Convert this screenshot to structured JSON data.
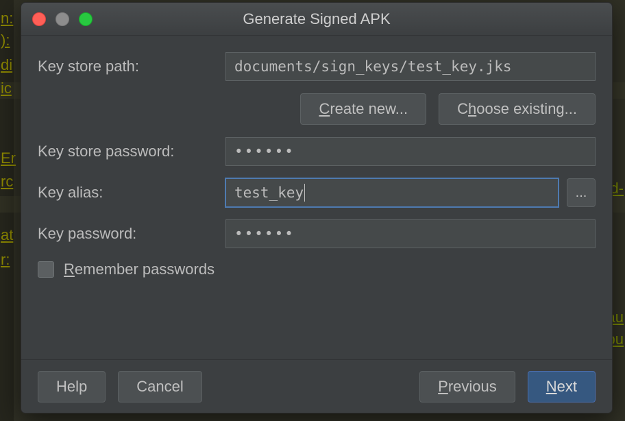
{
  "title": "Generate Signed APK",
  "form": {
    "keystore_path_label": "Key store path:",
    "keystore_path_value": "documents/sign_keys/test_key.jks",
    "create_new_label": "Create new...",
    "choose_existing_label": "Choose existing...",
    "keystore_password_label": "Key store password:",
    "keystore_password_value": "••••••",
    "key_alias_label": "Key alias:",
    "key_alias_value": "test_key",
    "key_alias_browse_label": "...",
    "key_password_label": "Key password:",
    "key_password_value": "••••••",
    "remember_label_pre": "R",
    "remember_label_rest": "emember passwords",
    "remember_checked": false
  },
  "footer": {
    "help_label": "Help",
    "cancel_label": "Cancel",
    "previous_label": "Previous",
    "next_label": "Next"
  },
  "colors": {
    "dialog_bg": "#3c3f41",
    "field_bg": "#45494a",
    "focus_border": "#4e7ab0",
    "primary_btn": "#365880"
  }
}
